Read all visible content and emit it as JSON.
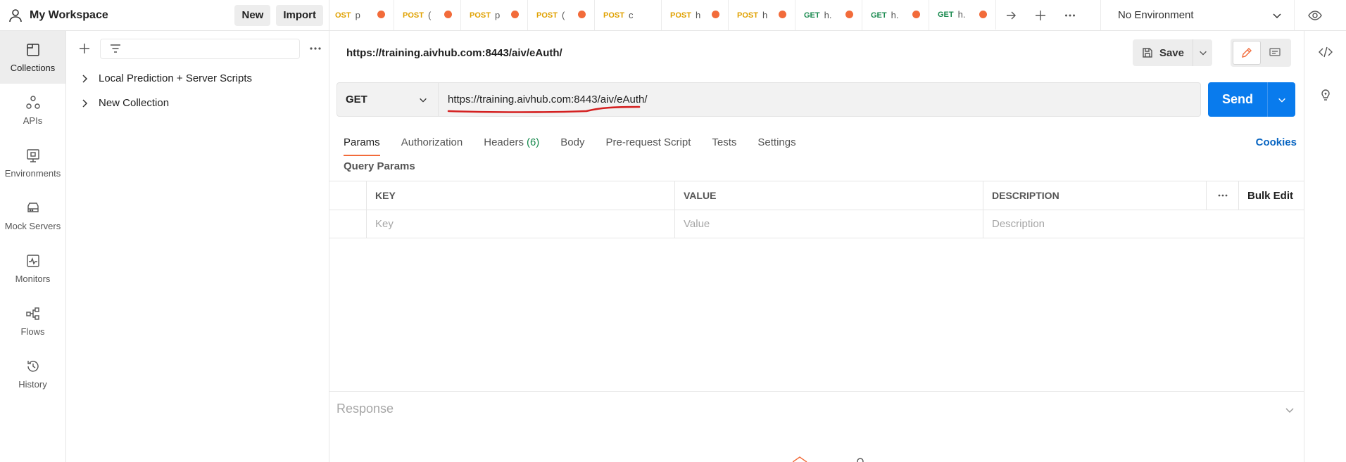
{
  "workspace": {
    "title": "My Workspace",
    "new_label": "New",
    "import_label": "Import"
  },
  "rail": [
    {
      "label": "Collections",
      "icon": "collections-icon",
      "active": true
    },
    {
      "label": "APIs",
      "icon": "apis-icon"
    },
    {
      "label": "Environments",
      "icon": "environments-icon"
    },
    {
      "label": "Mock Servers",
      "icon": "mock-servers-icon"
    },
    {
      "label": "Monitors",
      "icon": "monitors-icon"
    },
    {
      "label": "Flows",
      "icon": "flows-icon"
    },
    {
      "label": "History",
      "icon": "history-icon"
    }
  ],
  "sidebar": {
    "collections": [
      "Local Prediction + Server Scripts",
      "New Collection"
    ]
  },
  "tabs": [
    {
      "method": "OST",
      "name": "p",
      "kind": "post"
    },
    {
      "method": "POST",
      "name": "(",
      "kind": "post"
    },
    {
      "method": "POST",
      "name": "p",
      "kind": "post"
    },
    {
      "method": "POST",
      "name": "(",
      "kind": "post"
    },
    {
      "method": "POST",
      "name": "c",
      "kind": "post"
    },
    {
      "method": "POST",
      "name": "h",
      "kind": "post"
    },
    {
      "method": "POST",
      "name": "h",
      "kind": "post"
    },
    {
      "method": "GET",
      "name": "h.",
      "kind": "get"
    },
    {
      "method": "GET",
      "name": "h.",
      "kind": "get"
    },
    {
      "method": "GET",
      "name": "h.",
      "kind": "get",
      "active": true
    }
  ],
  "environment": {
    "selected": "No Environment"
  },
  "request": {
    "title": "https://training.aivhub.com:8443/aiv/eAuth/",
    "save_label": "Save",
    "method": "GET",
    "url": "https://training.aivhub.com:8443/aiv/eAuth/",
    "send_label": "Send"
  },
  "subtabs": {
    "params": "Params",
    "authorization": "Authorization",
    "headers": "Headers",
    "headers_count": "(6)",
    "body": "Body",
    "prerequest": "Pre-request Script",
    "tests": "Tests",
    "settings": "Settings",
    "cookies": "Cookies"
  },
  "query_params": {
    "title": "Query Params",
    "columns": {
      "key": "KEY",
      "value": "VALUE",
      "description": "DESCRIPTION",
      "bulk_edit": "Bulk Edit"
    },
    "placeholders": {
      "key": "Key",
      "value": "Value",
      "description": "Description"
    }
  },
  "response": {
    "label": "Response"
  },
  "colors": {
    "accent": "#f26b3a",
    "send": "#097bed",
    "post": "#e0a100",
    "get": "#1a8a4f",
    "link": "#0a66c2",
    "annotation": "#d42020"
  }
}
